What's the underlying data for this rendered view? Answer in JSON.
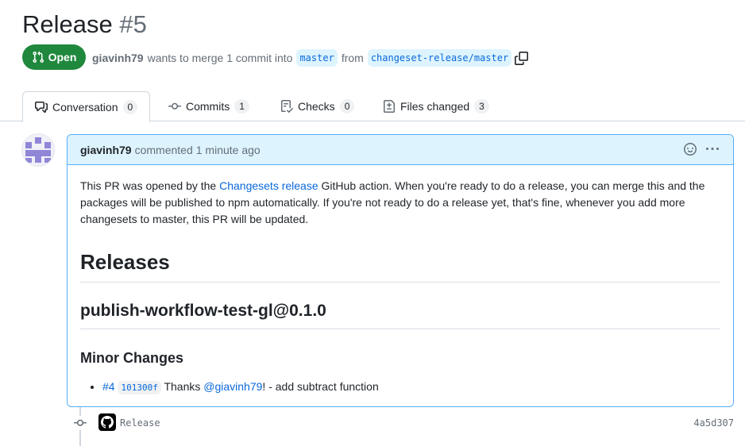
{
  "pr": {
    "title": "Release",
    "number": "#5",
    "state": "Open",
    "author": "giavinh79",
    "merge_text": "wants to merge 1 commit into",
    "base_branch": "master",
    "from_text": "from",
    "head_branch": "changeset-release/master"
  },
  "tabs": [
    {
      "label": "Conversation",
      "count": "0",
      "icon": "comment-discussion-icon"
    },
    {
      "label": "Commits",
      "count": "1",
      "icon": "git-commit-icon"
    },
    {
      "label": "Checks",
      "count": "0",
      "icon": "checklist-icon"
    },
    {
      "label": "Files changed",
      "count": "3",
      "icon": "file-diff-icon"
    }
  ],
  "comment": {
    "author": "giavinh79",
    "action": "commented",
    "timestamp": "1 minute ago",
    "intro_before": "This PR was opened by the ",
    "intro_link": "Changesets release",
    "intro_after": " GitHub action. When you're ready to do a release, you can merge this and the packages will be published to npm automatically. If you're not ready to do a release yet, that's fine, whenever you add more changesets to master, this PR will be updated.",
    "h1": "Releases",
    "h2": "publish-workflow-test-gl@0.1.0",
    "h3": "Minor Changes",
    "change": {
      "pr_ref": "#4",
      "sha": "101300f",
      "thanks": " Thanks ",
      "mention": "@giavinh79",
      "rest": "! - add subtract function"
    }
  },
  "timeline": {
    "commit_message": "Release",
    "commit_sha": "4a5d307"
  },
  "colors": {
    "open_green": "#1f883d",
    "accent_blue": "#0969da",
    "header_blue_bg": "#ddf4ff",
    "border_blue": "#54aeff"
  }
}
